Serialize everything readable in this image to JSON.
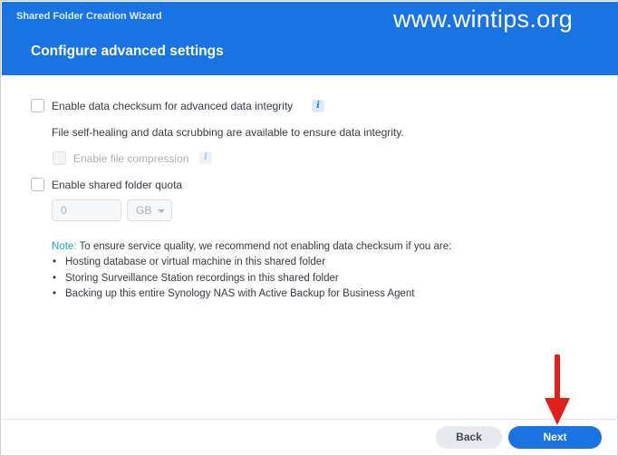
{
  "window": {
    "wizard_title": "Shared Folder Creation Wizard",
    "page_heading": "Configure advanced settings",
    "watermark": "www.wintips.org"
  },
  "settings": {
    "checksum": {
      "label": "Enable data checksum for advanced data integrity",
      "checked": false,
      "info_icon": "info-icon",
      "description": "File self-healing and data scrubbing are available to ensure data integrity."
    },
    "compression": {
      "label": "Enable file compression",
      "checked": false,
      "disabled": true,
      "info_icon": "info-icon"
    },
    "quota": {
      "label": "Enable shared folder quota",
      "checked": false,
      "value": "0",
      "unit": "GB",
      "disabled": true
    }
  },
  "note": {
    "label": "Note:",
    "text": "To ensure service quality, we recommend not enabling data checksum if you are:",
    "bullet_symbol": "•",
    "items": [
      "Hosting database or virtual machine in this shared folder",
      "Storing Surveillance Station recordings in this shared folder",
      "Backing up this entire Synology NAS with Active Backup for Business Agent"
    ]
  },
  "footer": {
    "back_label": "Back",
    "next_label": "Next"
  },
  "colors": {
    "header": "#1a73e3",
    "primary_button": "#1a73e3",
    "note_label": "#1fa9a9",
    "annotation_arrow": "#e0201b"
  }
}
